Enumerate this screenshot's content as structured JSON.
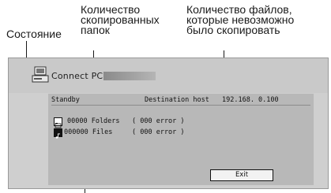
{
  "callouts": {
    "state": "Состояние",
    "copied_folders": "Количество\nскопированных\nпапок",
    "failed_files": "Количество файлов,\nкоторые невозможно\nбыло скопировать"
  },
  "window": {
    "title": "Connect PC",
    "status": "Standby",
    "destination_label": "Destination host",
    "destination_ip": "192.168. 0.100",
    "folders_count": "00000 Folders",
    "folders_error": "( 000 error )",
    "files_count": "000000 Files",
    "files_error": "( 000 error )",
    "exit_label": "Exit"
  },
  "icons": {
    "title": "computer-monitor-icon",
    "folders": "folder-icon",
    "files": "music-file-icon"
  }
}
